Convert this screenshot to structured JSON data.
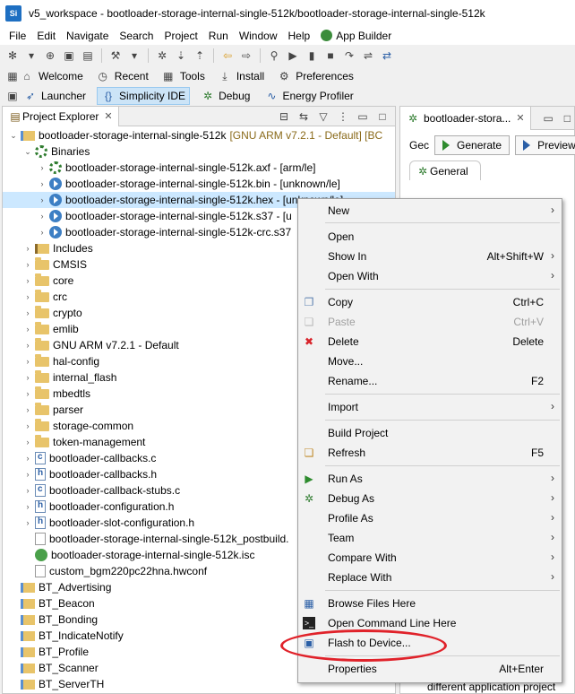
{
  "window": {
    "logo": "Si",
    "title": "v5_workspace - bootloader-storage-internal-single-512k/bootloader-storage-internal-single-512k"
  },
  "menubar": [
    "File",
    "Edit",
    "Navigate",
    "Search",
    "Project",
    "Run",
    "Window",
    "Help",
    "App Builder"
  ],
  "toolbar_nav": [
    "Welcome",
    "Recent",
    "Tools",
    "Install",
    "Preferences"
  ],
  "perspectives": [
    "Launcher",
    "Simplicity IDE",
    "Debug",
    "Energy Profiler"
  ],
  "project_explorer": {
    "tab_label": "Project Explorer",
    "tree": [
      {
        "label": "bootloader-storage-internal-single-512k",
        "decor": "[GNU ARM v7.2.1 - Default] [BC"
      },
      {
        "label": "Binaries"
      },
      {
        "label": "bootloader-storage-internal-single-512k.axf - [arm/le]"
      },
      {
        "label": "bootloader-storage-internal-single-512k.bin - [unknown/le]"
      },
      {
        "label": "bootloader-storage-internal-single-512k.hex - [unknown/le]"
      },
      {
        "label": "bootloader-storage-internal-single-512k.s37 - [u"
      },
      {
        "label": "bootloader-storage-internal-single-512k-crc.s37"
      },
      {
        "label": "Includes"
      },
      {
        "label": "CMSIS"
      },
      {
        "label": "core"
      },
      {
        "label": "crc"
      },
      {
        "label": "crypto"
      },
      {
        "label": "emlib"
      },
      {
        "label": "GNU ARM v7.2.1 - Default"
      },
      {
        "label": "hal-config"
      },
      {
        "label": "internal_flash"
      },
      {
        "label": "mbedtls"
      },
      {
        "label": "parser"
      },
      {
        "label": "storage-common"
      },
      {
        "label": "token-management"
      },
      {
        "label": "bootloader-callbacks.c"
      },
      {
        "label": "bootloader-callbacks.h"
      },
      {
        "label": "bootloader-callback-stubs.c"
      },
      {
        "label": "bootloader-configuration.h"
      },
      {
        "label": "bootloader-slot-configuration.h"
      },
      {
        "label": "bootloader-storage-internal-single-512k_postbuild."
      },
      {
        "label": "bootloader-storage-internal-single-512k.isc"
      },
      {
        "label": "custom_bgm220pc22hna.hwconf"
      },
      {
        "label": "BT_Advertising"
      },
      {
        "label": "BT_Beacon"
      },
      {
        "label": "BT_Bonding"
      },
      {
        "label": "BT_IndicateNotify"
      },
      {
        "label": "BT_Profile"
      },
      {
        "label": "BT_Scanner"
      },
      {
        "label": "BT_ServerTH"
      }
    ]
  },
  "editor": {
    "tab_label": "bootloader-stora...",
    "partial_label": "Gec",
    "generate_label": "Generate",
    "preview_label": "Preview",
    "general_tab": "General",
    "footer_text": "different application project"
  },
  "context_menu": {
    "items": [
      {
        "label": "New",
        "shortcut": "",
        "submenu": true
      },
      {
        "label": "Open",
        "shortcut": "",
        "submenu": false
      },
      {
        "label": "Show In",
        "shortcut": "Alt+Shift+W",
        "submenu": true
      },
      {
        "label": "Open With",
        "shortcut": "",
        "submenu": true
      },
      {
        "label": "Copy",
        "shortcut": "Ctrl+C",
        "submenu": false
      },
      {
        "label": "Paste",
        "shortcut": "Ctrl+V",
        "submenu": false
      },
      {
        "label": "Delete",
        "shortcut": "Delete",
        "submenu": false
      },
      {
        "label": "Move...",
        "shortcut": "",
        "submenu": false
      },
      {
        "label": "Rename...",
        "shortcut": "F2",
        "submenu": false
      },
      {
        "label": "Import",
        "shortcut": "",
        "submenu": true
      },
      {
        "label": "Build Project",
        "shortcut": "",
        "submenu": false
      },
      {
        "label": "Refresh",
        "shortcut": "F5",
        "submenu": false
      },
      {
        "label": "Run As",
        "shortcut": "",
        "submenu": true
      },
      {
        "label": "Debug As",
        "shortcut": "",
        "submenu": true
      },
      {
        "label": "Profile As",
        "shortcut": "",
        "submenu": true
      },
      {
        "label": "Team",
        "shortcut": "",
        "submenu": true
      },
      {
        "label": "Compare With",
        "shortcut": "",
        "submenu": true
      },
      {
        "label": "Replace With",
        "shortcut": "",
        "submenu": true
      },
      {
        "label": "Browse Files Here",
        "shortcut": "",
        "submenu": false
      },
      {
        "label": "Open Command Line Here",
        "shortcut": "",
        "submenu": false
      },
      {
        "label": "Flash to Device...",
        "shortcut": "",
        "submenu": false
      },
      {
        "label": "Properties",
        "shortcut": "Alt+Enter",
        "submenu": false
      }
    ]
  }
}
